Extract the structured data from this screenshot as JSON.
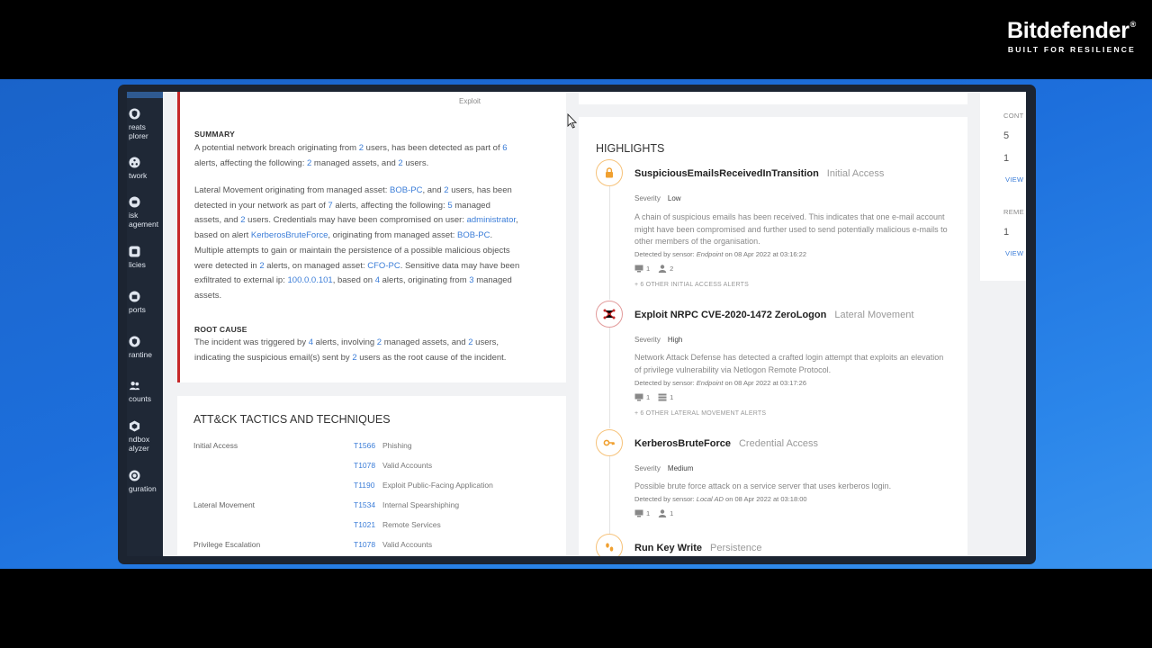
{
  "brand": {
    "name": "Bitdefender",
    "registered": "®",
    "tagline": "BUILT FOR RESILIENCE"
  },
  "colors": {
    "accent": "#3b7dd8",
    "severity_border": "#c62828",
    "sidebar": "#1f2836",
    "background": "#1d6fdc"
  },
  "sidebar": {
    "items": [
      {
        "icon": "shield-icon",
        "label1": "reats",
        "label2": "plorer"
      },
      {
        "icon": "network-icon",
        "label1": "twork",
        "label2": ""
      },
      {
        "icon": "risk-icon",
        "label1": "isk",
        "label2": "agement"
      },
      {
        "icon": "policies-icon",
        "label1": "licies",
        "label2": ""
      },
      {
        "icon": "reports-icon",
        "label1": "ports",
        "label2": ""
      },
      {
        "icon": "quarantine-icon",
        "label1": "rantine",
        "label2": ""
      },
      {
        "icon": "accounts-icon",
        "label1": "counts",
        "label2": ""
      },
      {
        "icon": "sandbox-icon",
        "label1": "ndbox",
        "label2": "alyzer"
      },
      {
        "icon": "configuration-icon",
        "label1": "guration",
        "label2": ""
      }
    ]
  },
  "incident": {
    "exploit_tag": "Exploit",
    "summary_title": "SUMMARY",
    "summary": {
      "p1": {
        "a": "A potential network breach originating from",
        "n1": "2",
        "b": "users, has been detected as part of",
        "n2": "6",
        "c": "alerts, affecting the following:",
        "n3": "2",
        "d": "managed assets, and",
        "n4": "2",
        "e": "users."
      },
      "p2": {
        "a": "Lateral Movement originating from managed asset:",
        "asset1": "BOB-PC",
        "b": ", and",
        "n1": "2",
        "c": "users, has been",
        "d": "detected in your network as part of",
        "n2": "7",
        "e": "alerts, affecting the following:",
        "n3": "5",
        "f": "managed",
        "g": "assets, and",
        "n4": "2",
        "h": "users. Credentials may have been compromised on user:",
        "user": "administrator",
        "i": ",",
        "j": "based on alert",
        "alert": "KerberosBruteForce",
        "k": ", originating from managed asset:",
        "asset2": "BOB-PC",
        "l": ".",
        "m": "Multiple attempts to gain or maintain the persistence of a possible malicious objects",
        "n": "were detected in",
        "n5": "2",
        "o": "alerts, on managed asset:",
        "asset3": "CFO-PC",
        "p": ". Sensitive data may have been",
        "q": "exfiltrated to external ip:",
        "ip": "100.0.0.101",
        "r": ", based on",
        "n6": "4",
        "s": "alerts, originating from",
        "n7": "3",
        "t": "managed",
        "u": "assets."
      }
    },
    "root_cause_title": "ROOT CAUSE",
    "root_cause": {
      "a": "The incident was triggered by",
      "n1": "4",
      "b": "alerts, involving",
      "n2": "2",
      "c": "managed assets, and",
      "n3": "2",
      "d": "users,",
      "e": "indicating the suspicious email(s) sent by",
      "n4": "2",
      "f": "users as the root cause of the incident."
    }
  },
  "attck": {
    "title": "ATT&CK TACTICS AND TECHNIQUES",
    "rows": [
      {
        "tactic": "Initial Access",
        "id": "T1566",
        "name": "Phishing"
      },
      {
        "tactic": "",
        "id": "T1078",
        "name": "Valid Accounts"
      },
      {
        "tactic": "",
        "id": "T1190",
        "name": "Exploit Public-Facing Application"
      },
      {
        "tactic": "Lateral Movement",
        "id": "T1534",
        "name": "Internal Spearshiphing"
      },
      {
        "tactic": "",
        "id": "T1021",
        "name": "Remote Services"
      },
      {
        "tactic": "Privilege Escalation",
        "id": "T1078",
        "name": "Valid Accounts"
      }
    ]
  },
  "highlights": {
    "title": "HIGHLIGHTS",
    "severity_label": "Severity",
    "alerts": [
      {
        "name": "SuspiciousEmailsReceivedInTransition",
        "tactic": "Initial Access",
        "severity": "Low",
        "icon": "lock-icon",
        "color": "#f0a030",
        "desc": "A chain of suspicious emails has been received. This indicates that one e-mail account might have been compromised and further used to send potentially malicious e-mails to other members of the organisation.",
        "detected_prefix": "Detected by sensor:",
        "sensor": "Endpoint",
        "detected_suffix": "on 08 Apr 2022 at 03:16:22",
        "count_a": "1",
        "count_b": "2",
        "more": "+ 6 OTHER INITIAL ACCESS ALERTS"
      },
      {
        "name": "Exploit NRPC CVE-2020-1472 ZeroLogon",
        "tactic": "Lateral Movement",
        "severity": "High",
        "icon": "spread-icon",
        "color": "#c62828",
        "desc": "Network Attack Defense has detected a crafted login attempt that exploits an elevation of privilege vulnerability via Netlogon Remote Protocol.",
        "detected_prefix": "Detected by sensor:",
        "sensor": "Endpoint",
        "detected_suffix": "on 08 Apr 2022 at 03:17:26",
        "count_a": "1",
        "count_b": "1",
        "more": "+ 6 OTHER LATERAL MOVEMENT ALERTS"
      },
      {
        "name": "KerberosBruteForce",
        "tactic": "Credential Access",
        "severity": "Medium",
        "icon": "key-icon",
        "color": "#f0a030",
        "desc": "Possible brute force attack on a service server that uses kerberos login.",
        "detected_prefix": "Detected by sensor:",
        "sensor": "Local AD",
        "detected_suffix": "on 08 Apr 2022 at 03:18:00",
        "count_a": "1",
        "count_b": "1",
        "more": ""
      },
      {
        "name": "Run Key Write",
        "tactic": "Persistence",
        "severity": "",
        "icon": "footprints-icon",
        "color": "#f0a030",
        "desc": "",
        "detected_prefix": "",
        "sensor": "",
        "detected_suffix": "",
        "count_a": "",
        "count_b": "",
        "more": ""
      }
    ]
  },
  "right_panel": {
    "label1": "CONT",
    "num1": "5",
    "num2": "1",
    "view1": "VIEW",
    "label2": "REME",
    "num3": "1",
    "view2": "VIEW"
  }
}
